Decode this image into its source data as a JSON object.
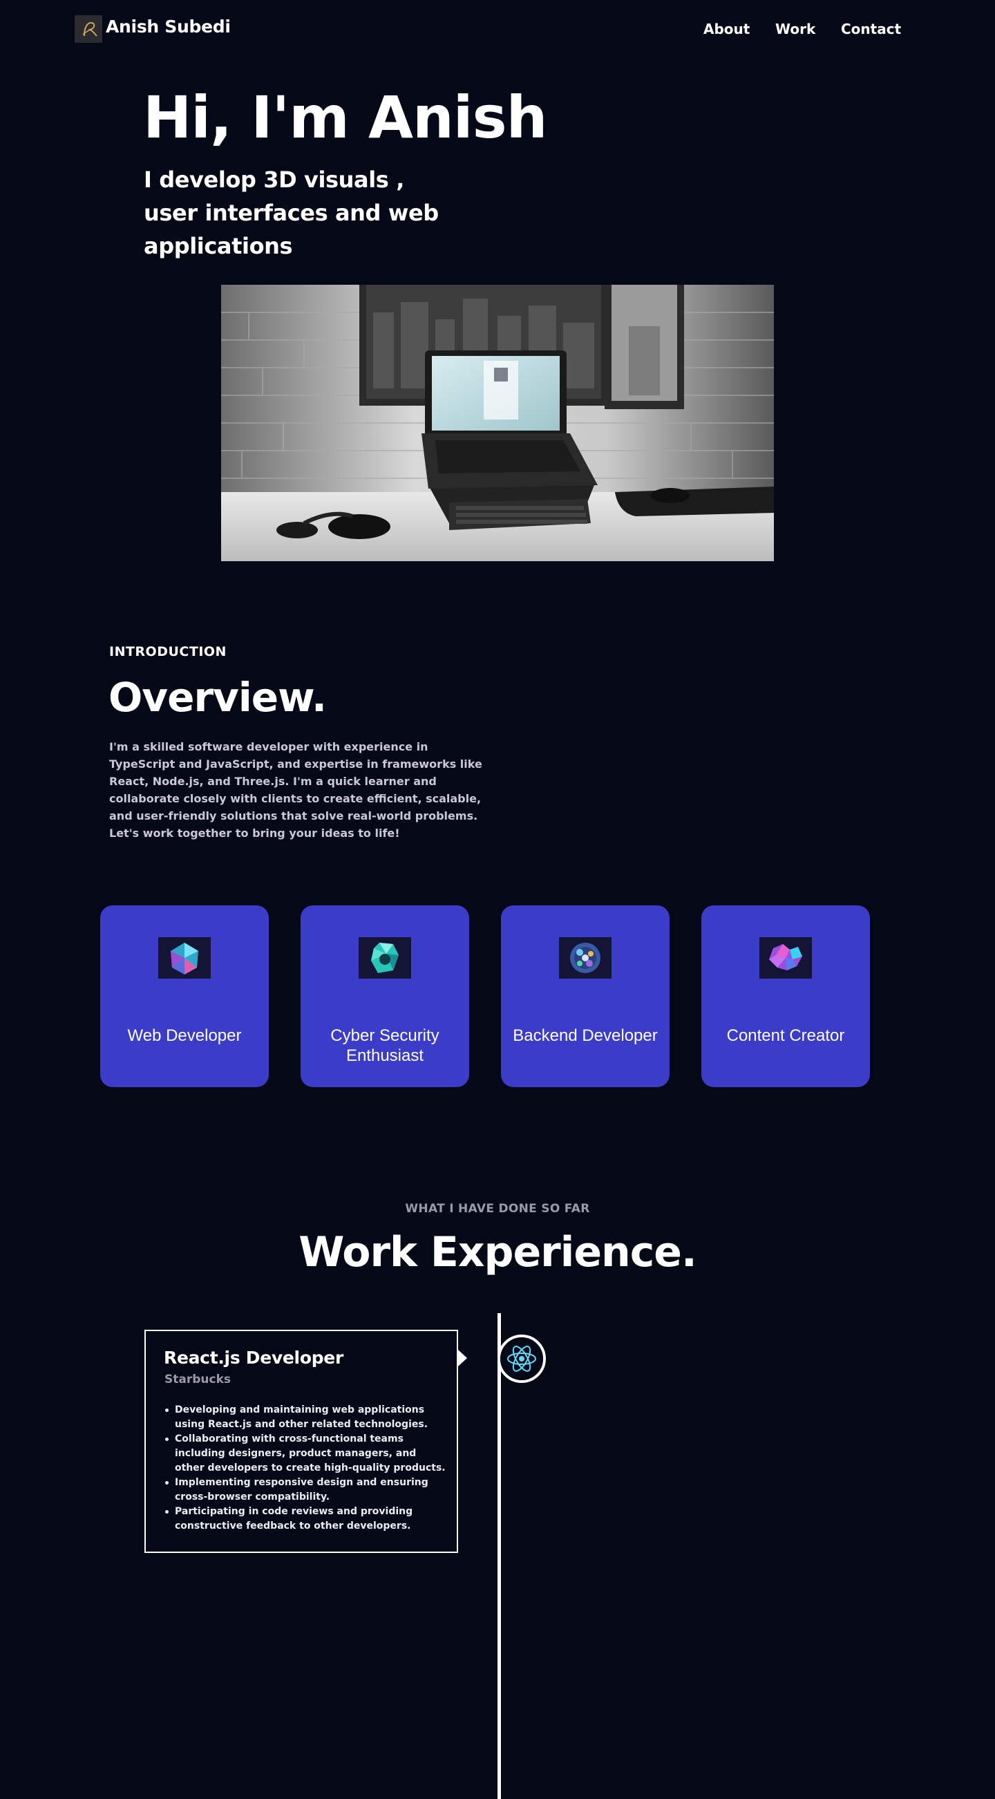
{
  "nav": {
    "brand": "Anish Subedi",
    "links": [
      "About",
      "Work",
      "Contact"
    ]
  },
  "hero": {
    "title": "Hi, I'm Anish",
    "subtitle": "I develop 3D visuals , user interfaces and web applications"
  },
  "overview": {
    "eyebrow": "INTRODUCTION",
    "title": "Overview.",
    "text": "I'm a skilled software developer with experience in TypeScript and JavaScript, and expertise in frameworks like React, Node.js, and Three.js. I'm a quick learner and collaborate closely with clients to create efficient, scalable, and user-friendly solutions that solve real-world problems. Let's work together to bring your ideas to life!"
  },
  "services": [
    {
      "label": "Web Developer",
      "icon": "web-developer-icon"
    },
    {
      "label": "Cyber Security Enthusiast",
      "icon": "cyber-security-icon"
    },
    {
      "label": "Backend Developer",
      "icon": "backend-developer-icon"
    },
    {
      "label": "Content Creator",
      "icon": "content-creator-icon"
    }
  ],
  "experience": {
    "eyebrow": "WHAT I HAVE DONE SO FAR",
    "title": "Work Experience.",
    "items": [
      {
        "role": "React.js Developer",
        "company": "Starbucks",
        "icon": "react-icon",
        "points": [
          "Developing and maintaining web applications using React.js and other related technologies.",
          "Collaborating with cross-functional teams including designers, product managers, and other developers to create high-quality products.",
          "Implementing responsive design and ensuring cross-browser compatibility.",
          "Participating in code reviews and providing constructive feedback to other developers."
        ]
      }
    ]
  },
  "colors": {
    "background": "#050816",
    "card": "#3b3cc8",
    "muted": "#9a99ab"
  }
}
